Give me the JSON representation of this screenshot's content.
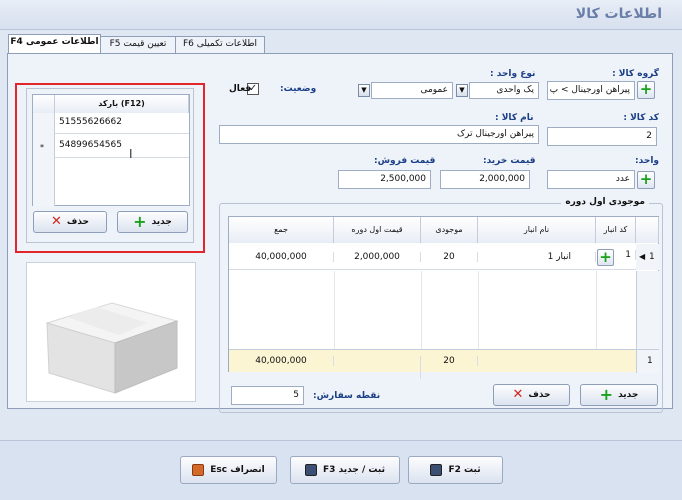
{
  "window": {
    "title": "اطلاعات کالا"
  },
  "tabs": [
    {
      "label": "اطلاعات عمومی F4",
      "active": true
    },
    {
      "label": "تعیین قیمت F5",
      "active": false
    },
    {
      "label": "اطلاعات تکمیلی F6",
      "active": false
    }
  ],
  "form": {
    "product_group_label": "گروه کالا :",
    "product_group_value": "پیراهن اورجینال > پ",
    "unit_type_label": "نوع واحد :",
    "unit_type_value": "یک واحدی",
    "unit_type_general": "عمومی",
    "status_label": "وضعیت:",
    "status_checkbox_label": "فعال",
    "product_code_label": "کد کالا :",
    "product_code_value": "2",
    "product_name_label": "نام کالا :",
    "product_name_value": "پیراهن اورجینال ترک",
    "unit_label": "واحد:",
    "unit_value": "عدد",
    "purchase_price_label": "قیمت خرید:",
    "purchase_price_value": "2,000,000",
    "sale_price_label": "قیمت فروش:",
    "sale_price_value": "2,500,000",
    "reorder_label": "نقطه سفارش:",
    "reorder_value": "5"
  },
  "barcode": {
    "header": "(F12) بارکد",
    "rows": [
      "51555626662",
      "54899654565"
    ],
    "new_marker": "*",
    "new_button": "جدید",
    "delete_button": "حذف"
  },
  "stock": {
    "title": "موجودی اول دوره",
    "columns": [
      "کد انبار",
      "نام انبار",
      "موجودی",
      "قیمت اول دوره",
      "جمع"
    ],
    "rows": [
      {
        "index": "1",
        "code": "1",
        "name": "انبار 1",
        "qty": "20",
        "price": "2,000,000",
        "total": "40,000,000"
      }
    ],
    "footer": {
      "index": "1",
      "qty": "20",
      "total": "40,000,000"
    },
    "new_button": "جدید",
    "delete_button": "حذف"
  },
  "footer": {
    "save_button": "ثبت F2",
    "save_new_button": "ثبت / جدید F3",
    "cancel_button": "انصراف Esc"
  }
}
